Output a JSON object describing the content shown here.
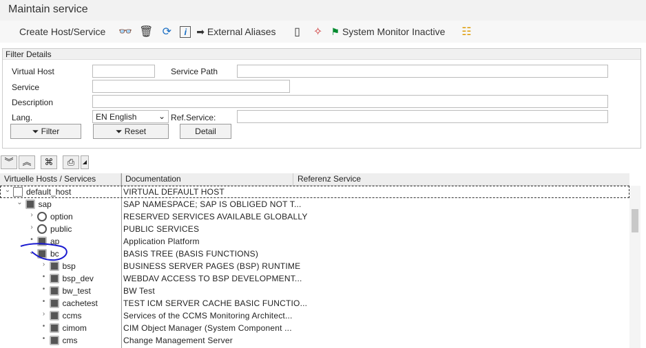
{
  "title": "Maintain service",
  "toolbar": {
    "create": "Create Host/Service",
    "external_aliases": "External Aliases",
    "system_monitor": "System Monitor Inactive",
    "flag_color": "#008a2e"
  },
  "filter": {
    "heading": "Filter Details",
    "virtual_host_label": "Virtual Host",
    "virtual_host": "",
    "service_path_label": "Service Path",
    "service_path": "",
    "service_label": "Service",
    "service": "",
    "description_label": "Description",
    "description": "",
    "lang_label": "Lang.",
    "lang": "EN English",
    "ref_service_label": "Ref.Service:",
    "ref_service": "",
    "filter_btn": "Filter",
    "reset_btn": "Reset",
    "detail_btn": "Detail"
  },
  "table": {
    "columns": [
      "Virtuelle Hosts / Services",
      "Documentation",
      "Referenz Service"
    ],
    "rows": [
      {
        "name": "default_host",
        "doc": "VIRTUAL DEFAULT HOST",
        "level": 0,
        "icon": "host",
        "exp": "⌄"
      },
      {
        "name": "sap",
        "doc": "SAP NAMESPACE; SAP IS OBLIGED NOT T...",
        "level": 1,
        "icon": "pkg",
        "exp": "⌄"
      },
      {
        "name": "option",
        "doc": "RESERVED SERVICES AVAILABLE GLOBALLY",
        "level": 2,
        "icon": "svc",
        "exp": "›"
      },
      {
        "name": "public",
        "doc": "PUBLIC SERVICES",
        "level": 2,
        "icon": "svc",
        "exp": "›"
      },
      {
        "name": "ap",
        "doc": "Application Platform",
        "level": 2,
        "icon": "pkg",
        "exp": "•"
      },
      {
        "name": "bc",
        "doc": "BASIS TREE (BASIS FUNCTIONS)",
        "level": 2,
        "icon": "pkg",
        "exp": "⌄"
      },
      {
        "name": "bsp",
        "doc": "BUSINESS SERVER PAGES (BSP) RUNTIME",
        "level": 3,
        "icon": "pkg",
        "exp": "›"
      },
      {
        "name": "bsp_dev",
        "doc": "WEBDAV ACCESS TO BSP DEVELOPMENT...",
        "level": 3,
        "icon": "pkg",
        "exp": "•"
      },
      {
        "name": "bw_test",
        "doc": "BW Test",
        "level": 3,
        "icon": "pkg",
        "exp": "•"
      },
      {
        "name": "cachetest",
        "doc": "TEST ICM SERVER CACHE BASIC FUNCTIO...",
        "level": 3,
        "icon": "pkg",
        "exp": "•"
      },
      {
        "name": "ccms",
        "doc": "Services of the CCMS Monitoring Architect...",
        "level": 3,
        "icon": "pkg",
        "exp": "›"
      },
      {
        "name": "cimom",
        "doc": "CIM Object Manager (System Component ...",
        "level": 3,
        "icon": "pkg",
        "exp": "•"
      },
      {
        "name": "cms",
        "doc": "Change Management Server",
        "level": 3,
        "icon": "pkg",
        "exp": "•"
      }
    ]
  }
}
